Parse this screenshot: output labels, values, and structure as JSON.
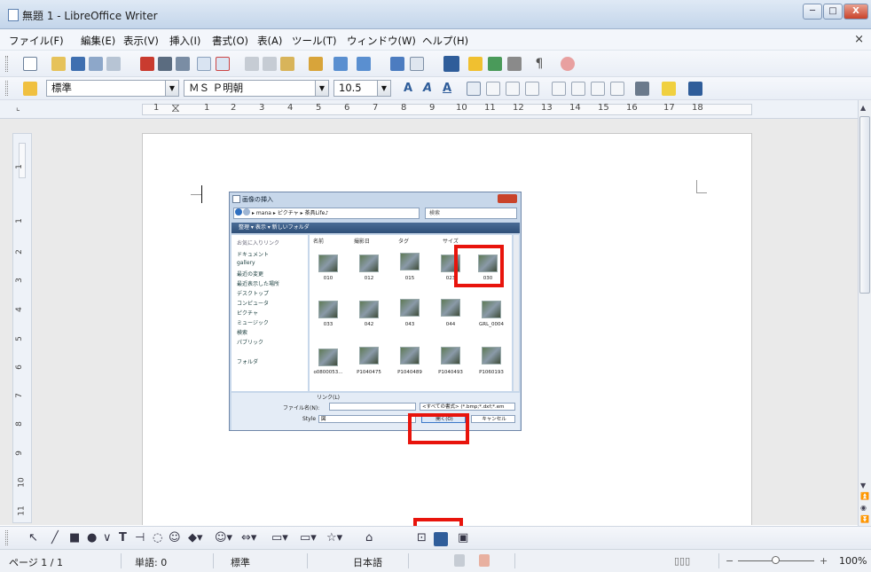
{
  "window": {
    "title": "無題 1 - LibreOffice Writer",
    "min": "─",
    "max": "□",
    "close": "X"
  },
  "menu": {
    "items": [
      "ファイル(F)",
      "編集(E)",
      "表示(V)",
      "挿入(I)",
      "書式(O)",
      "表(A)",
      "ツール(T)",
      "ウィンドウ(W)",
      "ヘルプ(H)"
    ],
    "close": "×"
  },
  "format_toolbar": {
    "style": "標準",
    "font": "ＭＳ Ｐ明朝",
    "size": "10.5"
  },
  "ruler": {
    "numbers": [
      "1",
      "1",
      "2",
      "3",
      "4",
      "5",
      "6",
      "7",
      "8",
      "9",
      "10",
      "11",
      "12",
      "13",
      "14",
      "15",
      "16",
      "17",
      "18"
    ]
  },
  "vruler": {
    "numbers": [
      "1",
      "1",
      "2",
      "3",
      "4",
      "5",
      "6",
      "7",
      "8",
      "9",
      "10",
      "11"
    ]
  },
  "dialog": {
    "title": "画像の挿入",
    "address": "▸ mana ▸ ピクチャ ▸ 茶具Life♪",
    "search": "検索",
    "cmdbar": "整理 ▾   表示 ▾   新しいフォルダ",
    "nav_header": "お気に入りリンク",
    "nav_items": [
      "ドキュメント",
      "gallery",
      "最近の変更",
      "最近表示した場所",
      "デスクトップ",
      "コンピュータ",
      "ピクチャ",
      "ミュージック",
      "検索",
      "パブリック"
    ],
    "folders_label": "フォルダ",
    "columns": [
      "名前",
      "撮影日",
      "タグ",
      "サイズ"
    ],
    "files": [
      "010",
      "012",
      "015",
      "023",
      "030",
      "033",
      "042",
      "043",
      "044",
      "GRL_0004",
      "o0800053...",
      "P1040475",
      "P1040489",
      "P1040493",
      "P1060193"
    ],
    "link_label": "リンク(L)",
    "filename_label": "ファイル名(N):",
    "style_label": "Style",
    "style_value": "図",
    "filter": "<すべての書式> (*.bmp;*.dxf;*.em",
    "open_button": "開く(O)",
    "cancel_button": "キャンセル"
  },
  "status": {
    "page": "ページ 1 / 1",
    "words": "単語: 0",
    "style": "標準",
    "lang": "日本語",
    "zoom": "100%"
  },
  "colors": {
    "highlight": "#e8140c",
    "titlebar": "#c3d5ea"
  }
}
